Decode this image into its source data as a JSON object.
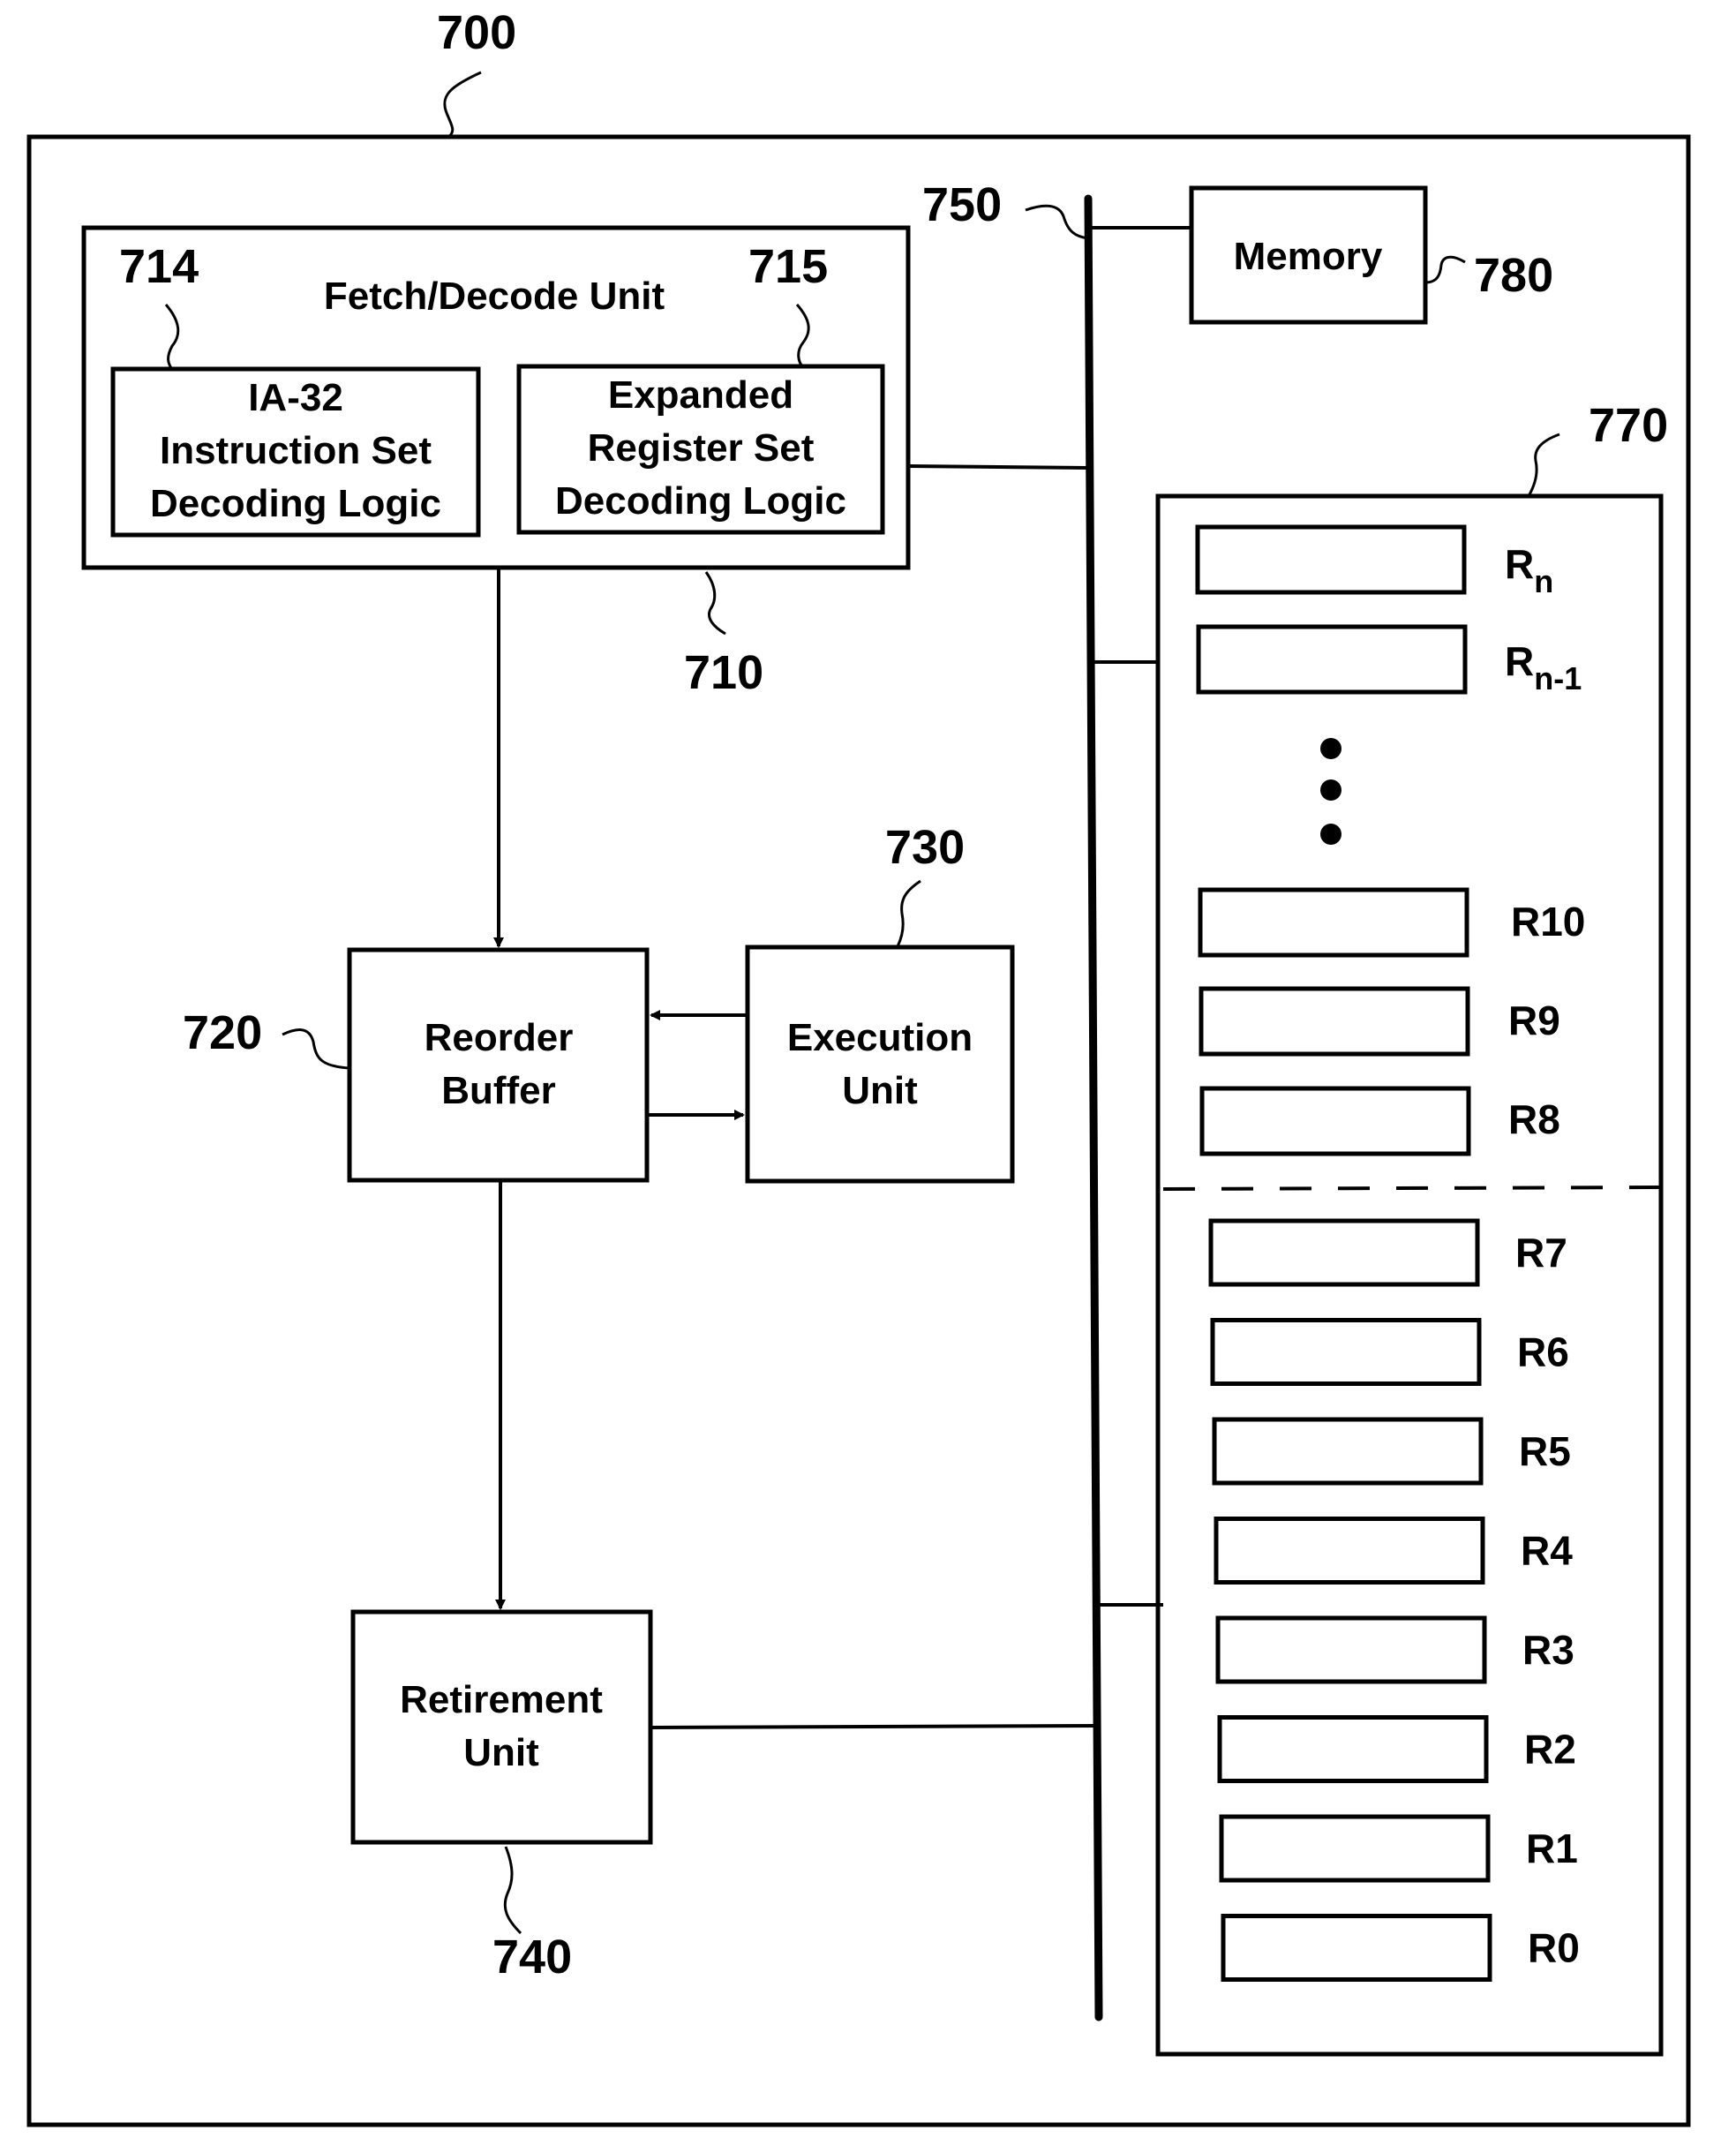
{
  "refs": {
    "system": "700",
    "fetch_decode": "710",
    "ia32": "714",
    "expanded": "715",
    "reorder": "720",
    "execution": "730",
    "retirement": "740",
    "bus": "750",
    "register_file": "770",
    "memory": "780"
  },
  "fetch_decode": {
    "title": "Fetch/Decode Unit",
    "ia32_lines": [
      "IA-32",
      "Instruction Set",
      "Decoding Logic"
    ],
    "expanded_lines": [
      "Expanded",
      "Register Set",
      "Decoding Logic"
    ]
  },
  "reorder": {
    "lines": [
      "Reorder",
      "Buffer"
    ]
  },
  "execution": {
    "lines": [
      "Execution",
      "Unit"
    ]
  },
  "retirement": {
    "lines": [
      "Retirement",
      "Unit"
    ]
  },
  "memory": {
    "label": "Memory"
  },
  "registers": {
    "upper": [
      {
        "base": "R",
        "sub": "n"
      },
      {
        "base": "R",
        "sub": "n-1"
      },
      {
        "base": "R10",
        "sub": ""
      },
      {
        "base": "R9",
        "sub": ""
      },
      {
        "base": "R8",
        "sub": ""
      }
    ],
    "lower": [
      "R7",
      "R6",
      "R5",
      "R4",
      "R3",
      "R2",
      "R1",
      "R0"
    ]
  }
}
